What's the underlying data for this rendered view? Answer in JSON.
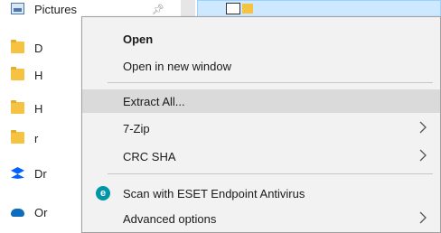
{
  "nav": {
    "items": [
      {
        "label": "Pictures",
        "icon": "pictures-icon"
      },
      {
        "label": "D",
        "icon": "folder-icon"
      },
      {
        "label": "H",
        "icon": "folder-icon"
      },
      {
        "label": "H",
        "icon": "folder-icon"
      },
      {
        "label": "r",
        "icon": "folder-icon"
      },
      {
        "label": "Dr",
        "icon": "dropbox-icon"
      },
      {
        "label": "Or",
        "icon": "onedrive-icon"
      }
    ]
  },
  "menu": {
    "open": "Open",
    "open_new_window": "Open in new window",
    "extract_all": "Extract All...",
    "seven_zip": "7-Zip",
    "crc_sha": "CRC SHA",
    "eset_scan": "Scan with ESET Endpoint Antivirus",
    "advanced_options": "Advanced options",
    "eset_icon_glyph": "e"
  },
  "colors": {
    "menu_bg": "#f2f2f2",
    "hover_bg": "#dadada",
    "selection_bg": "#cde8ff",
    "folder": "#f5c242",
    "eset": "#0096a8"
  }
}
